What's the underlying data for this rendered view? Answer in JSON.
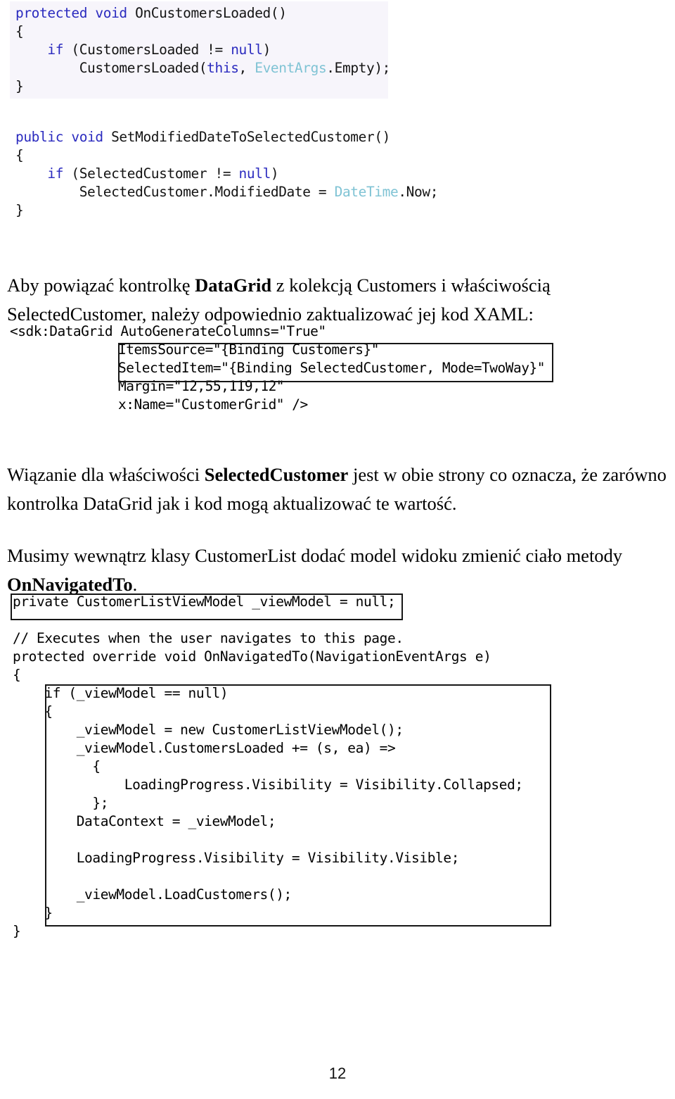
{
  "page": {
    "number": "12",
    "language": "pl"
  },
  "code_block_1": {
    "name": "OnCustomersLoaded method",
    "lines": [
      [
        {
          "t": "protected ",
          "c": "kw"
        },
        {
          "t": "void ",
          "c": "kw"
        },
        {
          "t": "OnCustomersLoaded()",
          "c": "plain"
        }
      ],
      [
        {
          "t": "{",
          "c": "plain"
        }
      ],
      [
        {
          "t": "    ",
          "c": "plain"
        },
        {
          "t": "if ",
          "c": "kw"
        },
        {
          "t": "(CustomersLoaded != ",
          "c": "plain"
        },
        {
          "t": "null",
          "c": "kw"
        },
        {
          "t": ")",
          "c": "plain"
        }
      ],
      [
        {
          "t": "        CustomersLoaded(",
          "c": "plain"
        },
        {
          "t": "this",
          "c": "kw"
        },
        {
          "t": ", ",
          "c": "plain"
        },
        {
          "t": "EventArgs",
          "c": "type"
        },
        {
          "t": ".Empty);",
          "c": "plain"
        }
      ],
      [
        {
          "t": "}",
          "c": "plain"
        }
      ]
    ]
  },
  "code_block_2": {
    "name": "SetModifiedDateToSelectedCustomer method",
    "lines": [
      [
        {
          "t": "public ",
          "c": "kw"
        },
        {
          "t": "void ",
          "c": "kw"
        },
        {
          "t": "SetModifiedDateToSelectedCustomer()",
          "c": "plain"
        }
      ],
      [
        {
          "t": "{",
          "c": "plain"
        }
      ],
      [
        {
          "t": "    ",
          "c": "plain"
        },
        {
          "t": "if ",
          "c": "kw"
        },
        {
          "t": "(SelectedCustomer != ",
          "c": "plain"
        },
        {
          "t": "null",
          "c": "kw"
        },
        {
          "t": ")",
          "c": "plain"
        }
      ],
      [
        {
          "t": "        SelectedCustomer.ModifiedDate = ",
          "c": "plain"
        },
        {
          "t": "DateTime",
          "c": "type"
        },
        {
          "t": ".Now;",
          "c": "plain"
        }
      ],
      [
        {
          "t": "}",
          "c": "plain"
        }
      ]
    ]
  },
  "paragraphs": {
    "p1_part1": "Aby powiązać kontrolkę ",
    "p1_bold1": "DataGrid",
    "p1_part2": " z kolekcją Customers i właściwością SelectedCustomer, należy odpowiednio zaktualizować jej kod XAML:",
    "p2_part1": "Wiązanie dla właściwości ",
    "p2_bold1": "SelectedCustomer",
    "p2_part2": " jest w obie strony co oznacza, że zarówno kontrolka DataGrid jak i kod mogą aktualizować te wartość.",
    "p3_part1": "Musimy wewnątrz klasy CustomerList dodać model widoku zmienić ciało metody ",
    "p3_bold1": "OnNavigatedTo",
    "p3_part2": "."
  },
  "xaml_block": {
    "name": "DataGrid XAML markup",
    "lines": [
      [
        {
          "t": "<sdk:DataGrid ",
          "c": "tag"
        },
        {
          "t": "AutoGenerateColumns=",
          "c": "attr"
        },
        {
          "t": "\"True\"",
          "c": "val"
        }
      ],
      [
        {
          "t": "INDENT",
          "c": "indent"
        },
        {
          "t": "ItemsSource=",
          "c": "attr"
        },
        {
          "t": "\"{Binding Customers}\"",
          "c": "val"
        }
      ],
      [
        {
          "t": "INDENT",
          "c": "indent"
        },
        {
          "t": "SelectedItem=",
          "c": "attr"
        },
        {
          "t": "\"{Binding SelectedCustomer, Mode=TwoWay}\"",
          "c": "val"
        }
      ],
      [
        {
          "t": "INDENT",
          "c": "indent"
        },
        {
          "t": "Margin=",
          "c": "attr"
        },
        {
          "t": "\"12,55,119,12\"",
          "c": "val"
        }
      ],
      [
        {
          "t": "INDENT",
          "c": "indent"
        },
        {
          "t": "x:Name=",
          "c": "attr"
        },
        {
          "t": "\"CustomerGrid\" ",
          "c": "val"
        },
        {
          "t": "/>",
          "c": "attr"
        }
      ]
    ],
    "highlight_box_label": "highlighted binding attributes"
  },
  "code_block_3": {
    "name": "OnNavigatedTo override",
    "lines": [
      [
        {
          "t": "private ",
          "c": "kw"
        },
        {
          "t": "CustomerListViewModel",
          "c": "type"
        },
        {
          "t": " _viewModel = ",
          "c": "plain"
        },
        {
          "t": "null",
          "c": "kw"
        },
        {
          "t": ";",
          "c": "plain"
        }
      ],
      [],
      [
        {
          "t": "// Executes when the user navigates to this page.",
          "c": "cmt"
        }
      ],
      [
        {
          "t": "protected override void ",
          "c": "kw"
        },
        {
          "t": "OnNavigatedTo(",
          "c": "plain"
        },
        {
          "t": "NavigationEventArgs",
          "c": "type"
        },
        {
          "t": " e)",
          "c": "plain"
        }
      ],
      [
        {
          "t": "{",
          "c": "plain"
        }
      ],
      [
        {
          "t": "    ",
          "c": "plain"
        },
        {
          "t": "if ",
          "c": "kw"
        },
        {
          "t": "(_viewModel == ",
          "c": "plain"
        },
        {
          "t": "null",
          "c": "kw"
        },
        {
          "t": ")",
          "c": "plain"
        }
      ],
      [
        {
          "t": "    {",
          "c": "plain"
        }
      ],
      [
        {
          "t": "        _viewModel = ",
          "c": "plain"
        },
        {
          "t": "new ",
          "c": "kw"
        },
        {
          "t": "CustomerListViewModel",
          "c": "type"
        },
        {
          "t": "();",
          "c": "plain"
        }
      ],
      [
        {
          "t": "        _viewModel.CustomersLoaded += (s, ea) =>",
          "c": "plain"
        }
      ],
      [
        {
          "t": "          {",
          "c": "plain"
        }
      ],
      [
        {
          "t": "              LoadingProgress.Visibility = ",
          "c": "plain"
        },
        {
          "t": "Visibility",
          "c": "type"
        },
        {
          "t": ".Collapsed;",
          "c": "plain"
        }
      ],
      [
        {
          "t": "          };",
          "c": "plain"
        }
      ],
      [
        {
          "t": "        DataContext = _viewModel;",
          "c": "plain"
        }
      ],
      [],
      [
        {
          "t": "        LoadingProgress.Visibility = ",
          "c": "plain"
        },
        {
          "t": "Visibility",
          "c": "type"
        },
        {
          "t": ".Visible;",
          "c": "plain"
        }
      ],
      [],
      [
        {
          "t": "        _viewModel.LoadCustomers();",
          "c": "plain"
        }
      ],
      [
        {
          "t": "    }",
          "c": "plain"
        }
      ],
      [
        {
          "t": "}",
          "c": "plain"
        }
      ]
    ],
    "decl_box_label": "highlighted field declaration",
    "body_box_label": "highlighted method body"
  },
  "colors": {
    "keyword": "#2b2bbf",
    "type": "#7fc3d4",
    "comment": "#2a8a28",
    "xaml_attribute": "#c01414",
    "xaml_value": "#1a1ad0",
    "xaml_tag": "#20208f",
    "callout_border": "#161616",
    "code_tint": "#f7f5fb"
  }
}
